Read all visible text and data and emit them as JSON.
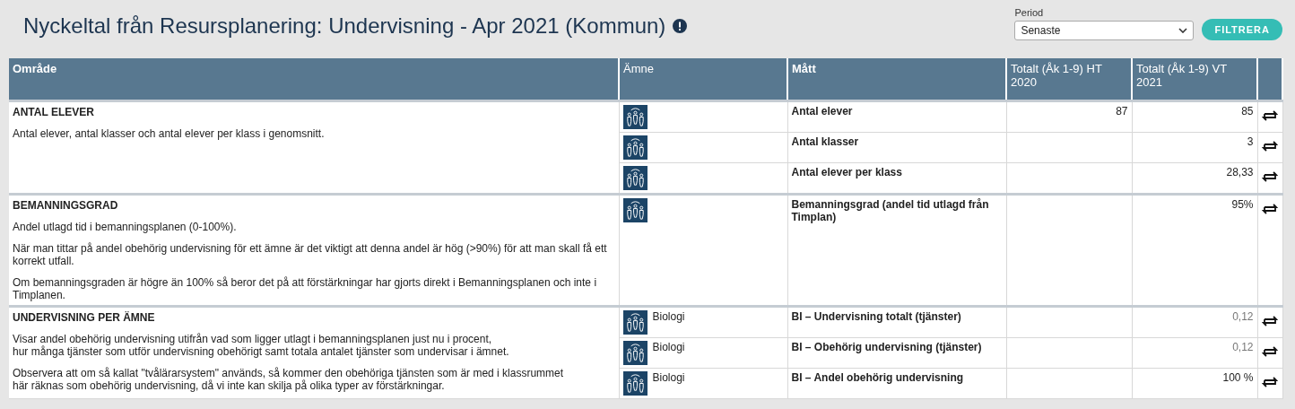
{
  "page": {
    "title": "Nyckeltal från Resursplanering: Undervisning - Apr 2021 (Kommun)"
  },
  "filter": {
    "label": "Period",
    "value": "Senaste",
    "button": "FILTRERA"
  },
  "table": {
    "columns": [
      "Område",
      "Ämne",
      "Mått",
      "Totalt (Åk 1-9) HT 2020",
      "Totalt (Åk 1-9) VT 2021"
    ],
    "groups": [
      {
        "title": "ANTAL ELEVER",
        "paragraphs": [
          "Antal elever, antal klasser och antal elever per klass i genomsnitt."
        ],
        "rows": [
          {
            "subject": "",
            "measure": "Antal elever",
            "ht": "87",
            "vt": "85",
            "dimmed": false
          },
          {
            "subject": "",
            "measure": "Antal klasser",
            "ht": "",
            "vt": "3",
            "dimmed": false
          },
          {
            "subject": "",
            "measure": "Antal elever per klass",
            "ht": "",
            "vt": "28,33",
            "dimmed": false
          }
        ]
      },
      {
        "title": "BEMANNINGSGRAD",
        "paragraphs": [
          "Andel utlagd tid i bemanningsplanen (0-100%).",
          "När man tittar på andel obehörig undervisning för ett ämne är det viktigt att denna andel är hög (>90%) för att man skall få ett korrekt utfall.",
          "Om bemanningsgraden är högre än 100% så beror det på att förstärkningar har gjorts direkt i Bemanningsplanen och inte i Timplanen."
        ],
        "rows": [
          {
            "subject": "",
            "measure": "Bemanningsgrad (andel tid utlagd från Timplan)",
            "ht": "",
            "vt": "95%",
            "dimmed": false
          }
        ]
      },
      {
        "title": "UNDERVISNING PER ÄMNE",
        "paragraphs": [
          "Visar andel obehörig undervisning utifrån vad som ligger utlagt i bemanningsplanen just nu i procent,\nhur många tjänster som utför undervisning obehörigt samt totala antalet tjänster som undervisar i ämnet.",
          "Observera att om så kallat \"tvålärarsystem\" används, så kommer den obehöriga tjänsten som är med i klassrummet\nhär räknas som obehörig undervisning, då vi inte kan skilja på olika typer av förstärkningar."
        ],
        "rows": [
          {
            "subject": "Biologi",
            "measure": "BI – Undervisning totalt (tjänster)",
            "ht": "",
            "vt": "0,12",
            "dimmed": true
          },
          {
            "subject": "Biologi",
            "measure": "BI – Obehörig undervisning (tjänster)",
            "ht": "",
            "vt": "0,12",
            "dimmed": true
          },
          {
            "subject": "Biologi",
            "measure": "BI – Andel obehörig undervisning",
            "ht": "",
            "vt": "100 %",
            "dimmed": false
          }
        ]
      }
    ]
  }
}
